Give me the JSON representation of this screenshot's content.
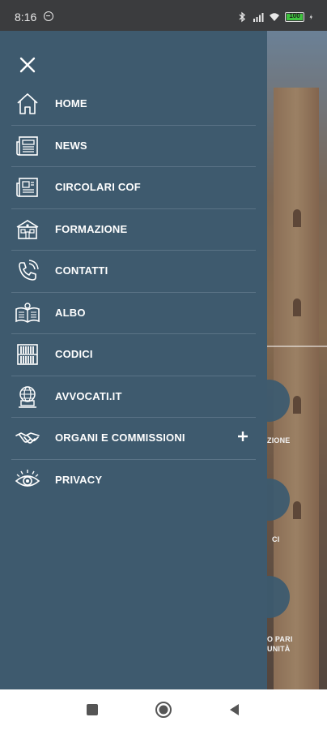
{
  "status_bar": {
    "time": "8:16",
    "battery": "100",
    "icons": [
      "do-not-disturb-icon",
      "bluetooth-icon",
      "signal-icon",
      "wifi-icon",
      "battery-icon",
      "charging-icon"
    ]
  },
  "drawer": {
    "close_icon": "close-icon",
    "menu": [
      {
        "label": "HOME",
        "icon": "home-icon"
      },
      {
        "label": "NEWS",
        "icon": "newspaper-icon"
      },
      {
        "label": "CIRCOLARI COF",
        "icon": "circular-document-icon"
      },
      {
        "label": "FORMAZIONE",
        "icon": "school-building-icon"
      },
      {
        "label": "CONTATTI",
        "icon": "phone-icon"
      },
      {
        "label": "ALBO",
        "icon": "open-book-icon"
      },
      {
        "label": "CODICI",
        "icon": "bookshelf-icon"
      },
      {
        "label": "AVVOCATI.IT",
        "icon": "globe-computer-icon"
      },
      {
        "label": "ORGANI E COMMISSIONI",
        "icon": "handshake-icon",
        "expandable": true
      },
      {
        "label": "PRIVACY",
        "icon": "eye-icon"
      }
    ]
  },
  "background": {
    "labels": [
      "ZIONE",
      "CI",
      "O PARI",
      "UNITÀ"
    ]
  },
  "nav_bar": {
    "icons": [
      "recents-icon",
      "home-circle-icon",
      "back-icon"
    ]
  },
  "colors": {
    "drawer_bg": "#3e5a6e",
    "divider": "#5a7386",
    "status_bar_bg": "#3b3c3e",
    "battery_fill": "#3fc23f"
  }
}
